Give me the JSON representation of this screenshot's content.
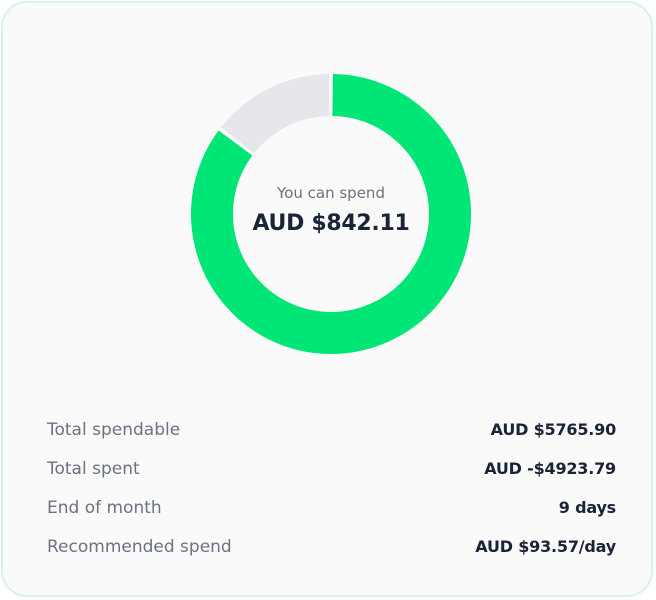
{
  "summary": {
    "center_label": "You can spend",
    "center_value": "AUD $842.11",
    "progress": {
      "remaining_fraction": 0.146,
      "remaining_color": "#00e676",
      "used_color": "#e5e7eb"
    }
  },
  "details": [
    {
      "label": "Total spendable",
      "value": "AUD $5765.90"
    },
    {
      "label": "Total spent",
      "value": "AUD -$4923.79"
    },
    {
      "label": "End of month",
      "value": "9 days"
    },
    {
      "label": "Recommended spend",
      "value": "AUD $93.57/day"
    }
  ],
  "colors": {
    "card_border": "#d9f1e6",
    "card_background": "#fafafa",
    "text_primary": "#1b2336",
    "text_secondary": "#6b7280"
  }
}
